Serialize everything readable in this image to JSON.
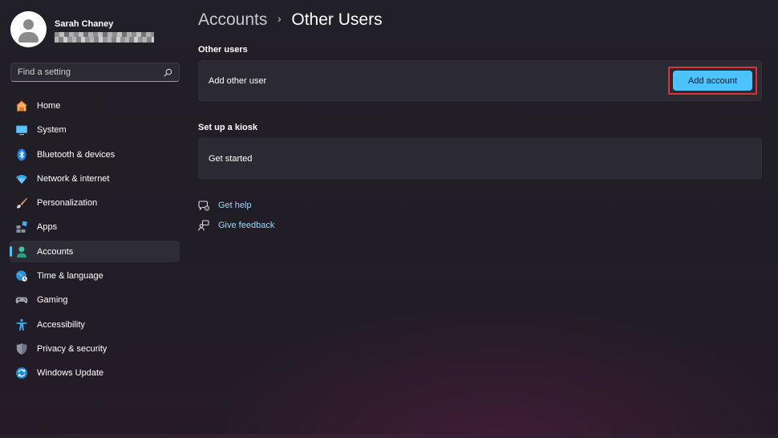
{
  "user": {
    "name": "Sarah Chaney"
  },
  "search": {
    "placeholder": "Find a setting"
  },
  "sidebar": {
    "items": [
      {
        "label": "Home",
        "icon": "home-icon",
        "active": false
      },
      {
        "label": "System",
        "icon": "display-icon",
        "active": false
      },
      {
        "label": "Bluetooth & devices",
        "icon": "bluetooth-icon",
        "active": false
      },
      {
        "label": "Network & internet",
        "icon": "wifi-icon",
        "active": false
      },
      {
        "label": "Personalization",
        "icon": "brush-icon",
        "active": false
      },
      {
        "label": "Apps",
        "icon": "apps-icon",
        "active": false
      },
      {
        "label": "Accounts",
        "icon": "person-icon",
        "active": true
      },
      {
        "label": "Time & language",
        "icon": "globe-clock-icon",
        "active": false
      },
      {
        "label": "Gaming",
        "icon": "controller-icon",
        "active": false
      },
      {
        "label": "Accessibility",
        "icon": "accessibility-icon",
        "active": false
      },
      {
        "label": "Privacy & security",
        "icon": "shield-icon",
        "active": false
      },
      {
        "label": "Windows Update",
        "icon": "update-icon",
        "active": false
      }
    ]
  },
  "breadcrumb": {
    "parent": "Accounts",
    "separator": "›",
    "current": "Other Users"
  },
  "other_users": {
    "section_title": "Other users",
    "card_label": "Add other user",
    "button_label": "Add account"
  },
  "kiosk": {
    "section_title": "Set up a kiosk",
    "card_label": "Get started"
  },
  "links": {
    "help": "Get help",
    "feedback": "Give feedback"
  },
  "colors": {
    "accent": "#4cc2ff",
    "highlight_box": "#e0323a",
    "background": "#211f27"
  }
}
